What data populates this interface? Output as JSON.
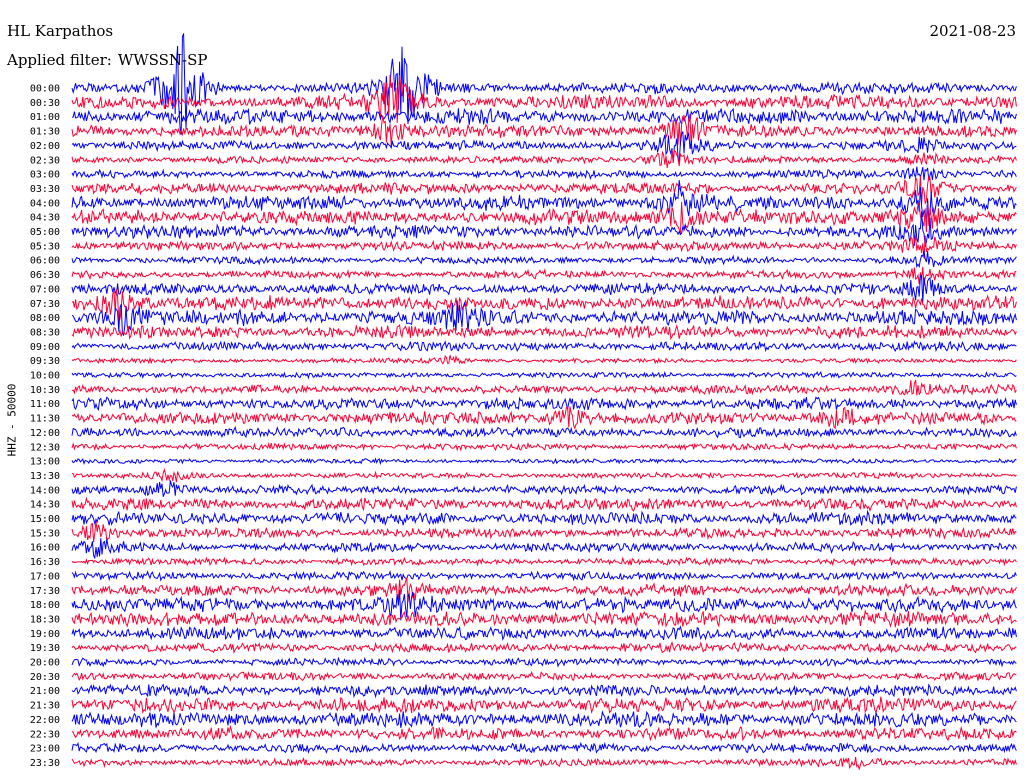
{
  "header": {
    "station": "HL Karpathos",
    "date": "2021-08-23",
    "filter_label": "Applied filter:",
    "filter_value": "WWSSN-SP"
  },
  "channel_label": "HHZ - 50000",
  "chart_data": {
    "type": "line",
    "title": "HL Karpathos",
    "rows": [
      "00:00",
      "00:30",
      "01:00",
      "01:30",
      "02:00",
      "02:30",
      "03:00",
      "03:30",
      "04:00",
      "04:30",
      "05:00",
      "05:30",
      "06:00",
      "06:30",
      "07:00",
      "07:30",
      "08:00",
      "08:30",
      "09:00",
      "09:30",
      "10:00",
      "10:30",
      "11:00",
      "11:30",
      "12:00",
      "12:30",
      "13:00",
      "13:30",
      "14:00",
      "14:30",
      "15:00",
      "15:30",
      "16:00",
      "16:30",
      "17:00",
      "17:30",
      "18:00",
      "18:30",
      "19:00",
      "19:30",
      "20:00",
      "20:30",
      "21:00",
      "21:30",
      "22:00",
      "22:30",
      "23:00",
      "23:30"
    ],
    "trace_colors": [
      "#0000ff",
      "#ff0033"
    ],
    "row_window_minutes": 30,
    "amplitude_scale": 50000,
    "events": [
      {
        "row": "00:00",
        "minute": 3.5,
        "amp": 12
      },
      {
        "row": "00:00",
        "minute": 10.5,
        "amp": 12
      },
      {
        "row": "00:30",
        "minute": 10.2,
        "amp": 6
      },
      {
        "row": "01:30",
        "minute": 10.0,
        "amp": 3
      },
      {
        "row": "01:30",
        "minute": 19.5,
        "amp": 3.5
      },
      {
        "row": "02:00",
        "minute": 19.2,
        "amp": 5
      },
      {
        "row": "02:30",
        "minute": 19.0,
        "amp": 4
      },
      {
        "row": "04:00",
        "minute": 19.3,
        "amp": 3
      },
      {
        "row": "04:30",
        "minute": 19.3,
        "amp": 2.5
      },
      {
        "row": "02:00",
        "minute": 27.0,
        "amp": 1.8
      },
      {
        "row": "02:30",
        "minute": 27.0,
        "amp": 2.2
      },
      {
        "row": "03:00",
        "minute": 27.0,
        "amp": 2.5
      },
      {
        "row": "03:30",
        "minute": 27.0,
        "amp": 2.8
      },
      {
        "row": "04:00",
        "minute": 27.0,
        "amp": 3.0
      },
      {
        "row": "04:30",
        "minute": 27.0,
        "amp": 3.0
      },
      {
        "row": "05:00",
        "minute": 27.0,
        "amp": 3.0
      },
      {
        "row": "05:30",
        "minute": 27.0,
        "amp": 3.0
      },
      {
        "row": "06:00",
        "minute": 27.0,
        "amp": 3.0
      },
      {
        "row": "06:30",
        "minute": 27.0,
        "amp": 2.8
      },
      {
        "row": "07:00",
        "minute": 27.0,
        "amp": 2.2
      },
      {
        "row": "07:30",
        "minute": 1.5,
        "amp": 2.5
      },
      {
        "row": "08:00",
        "minute": 1.7,
        "amp": 2.5
      },
      {
        "row": "08:00",
        "minute": 12.3,
        "amp": 2.0
      },
      {
        "row": "09:30",
        "minute": 12.0,
        "amp": 2.0
      },
      {
        "row": "10:30",
        "minute": 26.7,
        "amp": 2.0
      },
      {
        "row": "11:30",
        "minute": 24.4,
        "amp": 2.5
      },
      {
        "row": "11:30",
        "minute": 15.8,
        "amp": 2.0
      },
      {
        "row": "13:30",
        "minute": 3.2,
        "amp": 2.5
      },
      {
        "row": "14:00",
        "minute": 3.0,
        "amp": 2.5
      },
      {
        "row": "15:30",
        "minute": 0.8,
        "amp": 2.5
      },
      {
        "row": "16:00",
        "minute": 0.8,
        "amp": 2.0
      },
      {
        "row": "17:30",
        "minute": 10.6,
        "amp": 2.0
      },
      {
        "row": "18:00",
        "minute": 10.6,
        "amp": 2.5
      },
      {
        "row": "22:00",
        "minute": 31.8,
        "amp": 2.5
      },
      {
        "row": "23:30",
        "minute": 25.0,
        "amp": 1.5
      }
    ]
  }
}
